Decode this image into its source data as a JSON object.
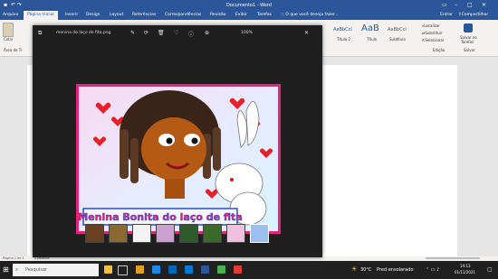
{
  "window": {
    "title": "Documento1 - Word",
    "search_placeholder": "O que você deseja fazer..."
  },
  "tabs": [
    "Arquivo",
    "Página Inicial",
    "Inserir",
    "Design",
    "Layout",
    "Referências",
    "Correspondências",
    "Revisão",
    "Exibir",
    "Tarefas"
  ],
  "account": {
    "signin": "Entrar",
    "share": "Compartilhar"
  },
  "ribbon": {
    "paste": "Colar",
    "clipboard_group": "Área de Tr",
    "style_normal_preview": "AaBbCcI",
    "style_normal": "Título 2",
    "style_title_preview": "AaB",
    "style_title": "Título",
    "style_subtitle_preview": "AaBbCcI",
    "style_subtitle": "Subtítulo",
    "find": "Localizar",
    "replace": "Substituir",
    "select": "Selecionar",
    "editing_group": "Edição",
    "sensitivity": "Salvar no",
    "sensitivity2": "Tarefas",
    "sensitivity_group": "Salvar"
  },
  "viewer": {
    "filename": "menina do laço de fita.png",
    "zoom": "100%",
    "caption": "Menina Bonita do laço de fita",
    "thumbnails_count": 8
  },
  "statusbar": {
    "page": "Página 1 de 1",
    "words": "0 palavra"
  },
  "taskbar": {
    "search": "Pesquisar",
    "weather_temp": "30°C",
    "weather_desc": "Pred ensolarado",
    "time": "14:13",
    "date": "01/11/2021"
  },
  "colors": {
    "word_blue": "#2b579a",
    "viewer_bg": "#1f1f1f",
    "frame_pink": "#e6257a",
    "caption_blue": "#2a4fbf"
  }
}
